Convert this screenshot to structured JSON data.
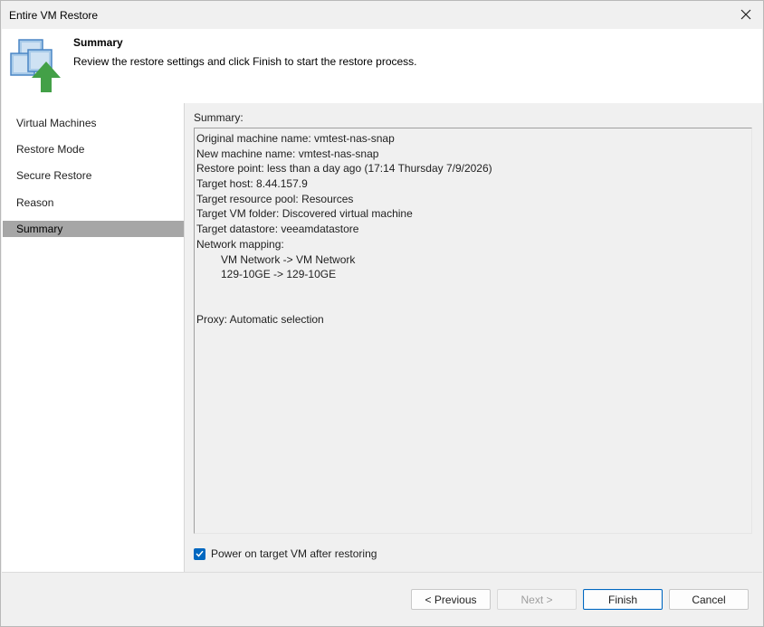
{
  "window": {
    "title": "Entire VM Restore"
  },
  "header": {
    "title": "Summary",
    "description": "Review the restore settings and click Finish to start the restore process.",
    "icon": "vm-restore-icon"
  },
  "sidebar": {
    "items": [
      {
        "label": "Virtual Machines",
        "selected": false
      },
      {
        "label": "Restore Mode",
        "selected": false
      },
      {
        "label": "Secure Restore",
        "selected": false
      },
      {
        "label": "Reason",
        "selected": false
      },
      {
        "label": "Summary",
        "selected": true
      }
    ]
  },
  "summary": {
    "label": "Summary:",
    "lines": [
      "Original machine name: vmtest-nas-snap",
      "New machine name: vmtest-nas-snap",
      "Restore point: less than a day ago (17:14 Thursday 7/9/2026)",
      "Target host: 8.44.157.9",
      "Target resource pool: Resources",
      "Target VM folder: Discovered virtual machine",
      "Target datastore: veeamdatastore",
      "Network mapping:"
    ],
    "network_mappings": [
      "VM Network -> VM Network",
      "129-10GE -> 129-10GE"
    ],
    "proxy": "Proxy: Automatic selection"
  },
  "options": {
    "power_on_label": "Power on target VM after restoring",
    "power_on_checked": true
  },
  "buttons": {
    "previous": "< Previous",
    "next": "Next >",
    "finish": "Finish",
    "cancel": "Cancel"
  },
  "colors": {
    "accent": "#0067c0",
    "selected_nav": "#a6a6a6",
    "icon_blue": "#5b9bd5",
    "icon_green": "#4caf50"
  }
}
